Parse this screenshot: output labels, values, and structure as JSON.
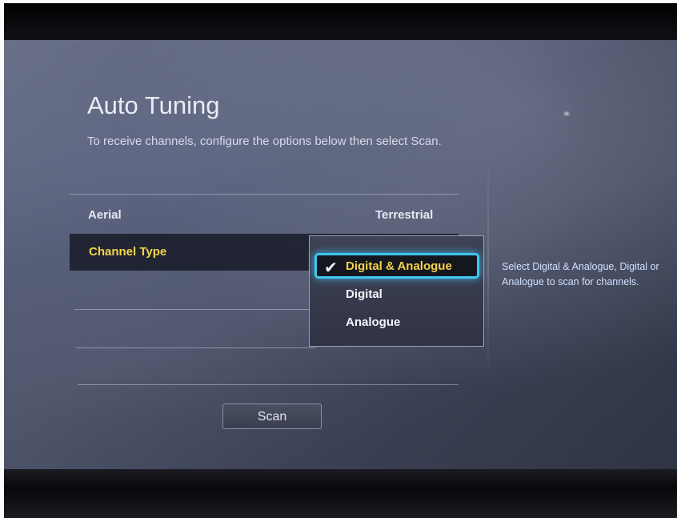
{
  "screen": {
    "title": "Auto Tuning",
    "subtitle": "To receive channels, configure the options below then select Scan."
  },
  "settings": {
    "aerial": {
      "label": "Aerial",
      "value": "Terrestrial"
    },
    "channel_type": {
      "label": "Channel Type"
    }
  },
  "dropdown": {
    "options": [
      "Digital & Analogue",
      "Digital",
      "Analogue"
    ],
    "selected": "Digital & Analogue",
    "check_glyph": "✔"
  },
  "help_text": "Select Digital & Analogue, Digital or Analogue to scan for channels.",
  "scan_button": {
    "label": "Scan"
  },
  "colors": {
    "highlight_text": "#f2d64a",
    "focus_border": "#3ec6f0",
    "help_text": "#cfe0ff"
  }
}
